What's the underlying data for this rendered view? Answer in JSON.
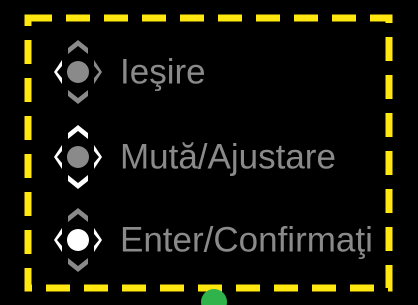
{
  "colors": {
    "background": "#000000",
    "frame_dash": "#ffe70f",
    "label_text": "#8a8a8a",
    "icon_gray": "#8a8a8a",
    "icon_white": "#ffffff",
    "indicator_green": "#2fb34a"
  },
  "menu": {
    "items": [
      {
        "label": "Ieşire",
        "icon": "joystick-left-press-icon",
        "active_direction": "left"
      },
      {
        "label": "Mută/Ajustare",
        "icon": "joystick-move-icon",
        "active_direction": "all"
      },
      {
        "label": "Enter/Confirmaţi",
        "icon": "joystick-center-press-icon",
        "active_direction": "center"
      }
    ]
  }
}
